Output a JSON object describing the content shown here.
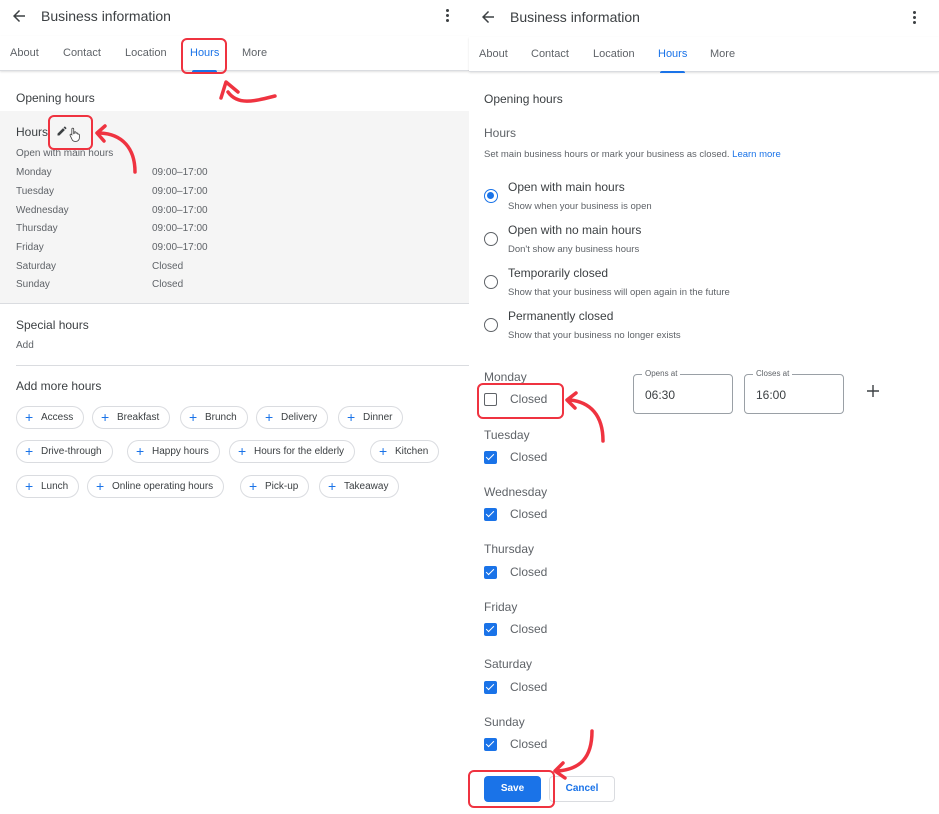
{
  "left": {
    "header": {
      "title": "Business information",
      "back_icon": "arrow-back-icon",
      "menu_icon": "more-vert-icon"
    },
    "tabs": [
      {
        "label": "About",
        "active": false
      },
      {
        "label": "Contact",
        "active": false
      },
      {
        "label": "Location",
        "active": false
      },
      {
        "label": "Hours",
        "active": true
      },
      {
        "label": "More",
        "active": false
      }
    ],
    "opening_hours_title": "Opening hours",
    "hours": {
      "label": "Hours",
      "edit_icon": "pencil-icon",
      "status": "Open with main hours",
      "days": [
        {
          "day": "Monday",
          "time": "09:00–17:00"
        },
        {
          "day": "Tuesday",
          "time": "09:00–17:00"
        },
        {
          "day": "Wednesday",
          "time": "09:00–17:00"
        },
        {
          "day": "Thursday",
          "time": "09:00–17:00"
        },
        {
          "day": "Friday",
          "time": "09:00–17:00"
        },
        {
          "day": "Saturday",
          "time": "Closed"
        },
        {
          "day": "Sunday",
          "time": "Closed"
        }
      ]
    },
    "special_hours": {
      "title": "Special hours",
      "action": "Add"
    },
    "more_hours": {
      "title": "Add more hours",
      "chips": [
        "Access",
        "Breakfast",
        "Brunch",
        "Delivery",
        "Dinner",
        "Drive-through",
        "Happy hours",
        "Hours for the elderly",
        "Kitchen",
        "Lunch",
        "Online operating hours",
        "Pick-up",
        "Takeaway"
      ]
    }
  },
  "right": {
    "header": {
      "title": "Business information"
    },
    "tabs": [
      {
        "label": "About",
        "active": false
      },
      {
        "label": "Contact",
        "active": false
      },
      {
        "label": "Location",
        "active": false
      },
      {
        "label": "Hours",
        "active": true
      },
      {
        "label": "More",
        "active": false
      }
    ],
    "opening_hours_title": "Opening hours",
    "hours_title": "Hours",
    "hours_desc": "Set main business hours or mark your business as closed.",
    "learn_more": "Learn more",
    "options": [
      {
        "label": "Open with main hours",
        "sub": "Show when your business is open",
        "selected": true
      },
      {
        "label": "Open with no main hours",
        "sub": "Don't show any business hours",
        "selected": false
      },
      {
        "label": "Temporarily closed",
        "sub": "Show that your business will open again in the future",
        "selected": false
      },
      {
        "label": "Permanently closed",
        "sub": "Show that your business no longer exists",
        "selected": false
      }
    ],
    "days": [
      {
        "day": "Monday",
        "closed_label": "Closed",
        "closed": false,
        "opens_label": "Opens at",
        "opens": "06:30",
        "closes_label": "Closes at",
        "closes": "16:00"
      },
      {
        "day": "Tuesday",
        "closed_label": "Closed",
        "closed": true
      },
      {
        "day": "Wednesday",
        "closed_label": "Closed",
        "closed": true
      },
      {
        "day": "Thursday",
        "closed_label": "Closed",
        "closed": true
      },
      {
        "day": "Friday",
        "closed_label": "Closed",
        "closed": true
      },
      {
        "day": "Saturday",
        "closed_label": "Closed",
        "closed": true
      },
      {
        "day": "Sunday",
        "closed_label": "Closed",
        "closed": true
      }
    ],
    "save_label": "Save",
    "cancel_label": "Cancel"
  },
  "colors": {
    "accent": "#1a73e8",
    "annotation": "#ef3340",
    "hours_bg": "#f5f5f5"
  }
}
